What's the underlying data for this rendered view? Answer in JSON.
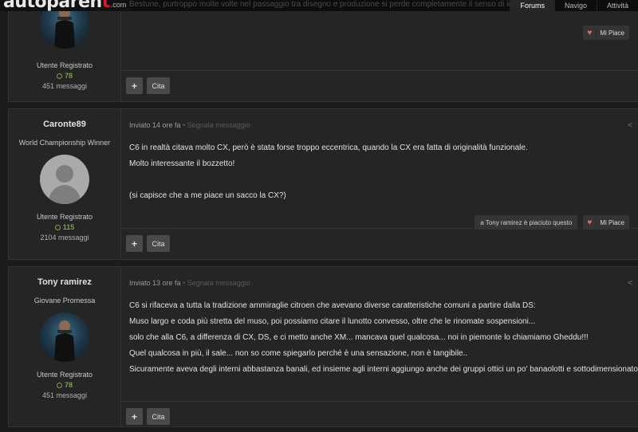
{
  "header": {
    "logo_main": "autoparen",
    "logo_accent": "t",
    "logo_suffix": ".com",
    "nav": [
      "Forums",
      "Navigo",
      "Attività"
    ]
  },
  "ghost_text": "Bestune, purtroppo molte volte nel passaggio tra disegno e produzione si perde completamente il senso di idea",
  "posts": [
    {
      "username": "",
      "title": "",
      "group": "Utente Registrato",
      "reputation": "78",
      "messages": "451 messaggi",
      "like_label": "Mi Piace",
      "plus": "+",
      "quote": "Cita"
    },
    {
      "username": "Caronte89",
      "title": "World Championship Winner",
      "group": "Utente Registrato",
      "reputation": "115",
      "messages": "2104 messaggi",
      "posted": "Inviato 14 ore fa",
      "report": " • Segnala messaggio",
      "lines": [
        "C6 in realtà citava molto CX, però è stata forse troppo eccentrica, quando la CX era fatta di originalità funzionale.",
        "Molto interessante il bozzetto!",
        "",
        "(si capisce che a me piace un sacco la CX?)"
      ],
      "liked_by": "a Tony ramirez è piaciuto questo",
      "like_label": "Mi Piace",
      "plus": "+",
      "quote": "Cita",
      "share_icon": "share-icon"
    },
    {
      "username": "Tony ramirez",
      "title": "Giovane Promessa",
      "group": "Utente Registrato",
      "reputation": "78",
      "messages": "451 messaggi",
      "posted": "Inviato 13 ore fa",
      "report": " • Segnala messaggio",
      "lines": [
        "C6 si rifaceva a tutta la tradizione ammiraglie citroen che avevano diverse caratteristiche comuni a partire dalla DS:",
        "Muso largo e coda più stretta del muso, poi possiamo citare il lunotto convesso, oltre che le rinomate sospensioni...",
        "solo che alla C6, a differenza di CX, DS, e ci metto anche XM... mancava quel qualcosa... noi in piemonte lo chiamiamo Gheddu!!!",
        "Quel qualcosa in più, il sale... non so come spiegarlo perché è una sensazione, non è tangibile..",
        "Sicuramente aveva degli interni abbastanza banali, ed insieme agli interni aggiungo anche dei gruppi ottici un po' banaolotti e sottodimensionato"
      ],
      "plus": "+",
      "quote": "Cita",
      "share_icon": "share-icon"
    }
  ],
  "colors": {
    "background": "#1b1b1b",
    "panel": "#252525",
    "reputation": "#7aa63c",
    "logo_accent": "#d01f2f",
    "heart": "#e36a6a"
  }
}
